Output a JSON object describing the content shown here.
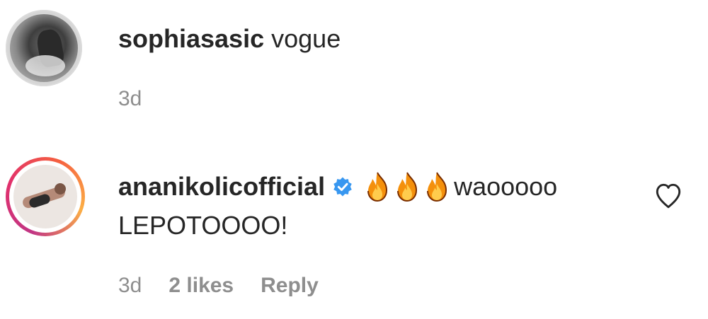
{
  "comments": [
    {
      "username": "sophiasasic",
      "text": "vogue",
      "time": "3d"
    },
    {
      "username": "ananikolicofficial",
      "verified": true,
      "emojis": [
        "fire-emoji",
        "fire-emoji",
        "fire-emoji"
      ],
      "text_line1": "waooooo",
      "text_line2": "LEPOTOOOO!",
      "time": "3d",
      "likes": "2 likes",
      "reply_label": "Reply",
      "liked": false
    }
  ],
  "colors": {
    "text": "#262626",
    "meta": "#8e8e8e",
    "verified_blue": "#3897f0",
    "story_ring": [
      "#c13584",
      "#e1306c",
      "#f56040",
      "#fcaf45"
    ]
  }
}
